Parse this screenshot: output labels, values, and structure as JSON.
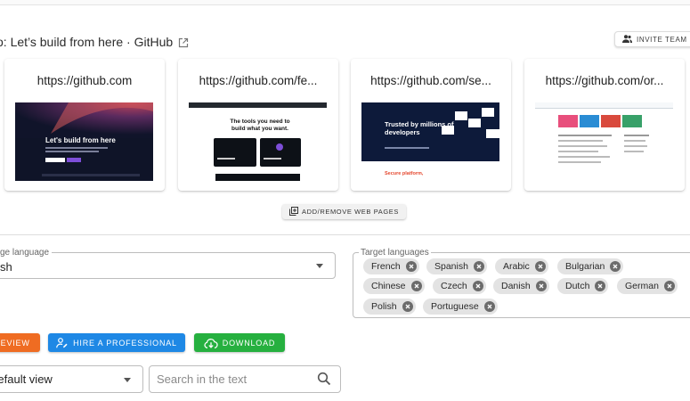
{
  "header": {
    "title": "o: Let’s build from here · GitHub",
    "invite_label": "INVITE TEAM M"
  },
  "pages": [
    {
      "url": "https://github.com",
      "thumb": "github-home"
    },
    {
      "url": "https://github.com/fe...",
      "thumb": "github-features",
      "thumb_heading": "The tools you need to build what you want."
    },
    {
      "url": "https://github.com/se...",
      "thumb": "github-security",
      "thumb_heading": "Trusted by millions of developers",
      "thumb_sub": "Secure platform,"
    },
    {
      "url": "https://github.com/or...",
      "thumb": "github-org"
    }
  ],
  "thumb_text": {
    "home_heading": "Let's build from here"
  },
  "add_pages_label": "ADD/REMOVE WEB PAGES",
  "source": {
    "legend": "ge language",
    "value": "sh"
  },
  "target": {
    "legend": "Target languages",
    "languages": [
      "French",
      "Spanish",
      "Arabic",
      "Bulgarian",
      "Chinese",
      "Czech",
      "Danish",
      "Dutch",
      "German",
      "Polish",
      "Portuguese"
    ]
  },
  "actions": {
    "review_label": "REVIEW",
    "hire_label": "HIRE A PROFESSIONAL",
    "download_label": "DOWNLOAD"
  },
  "view": {
    "value": "Default view"
  },
  "search": {
    "placeholder": "Search in the text"
  },
  "colors": {
    "review": "#ef6c22",
    "hire": "#1e88e5",
    "download": "#26b03f"
  }
}
